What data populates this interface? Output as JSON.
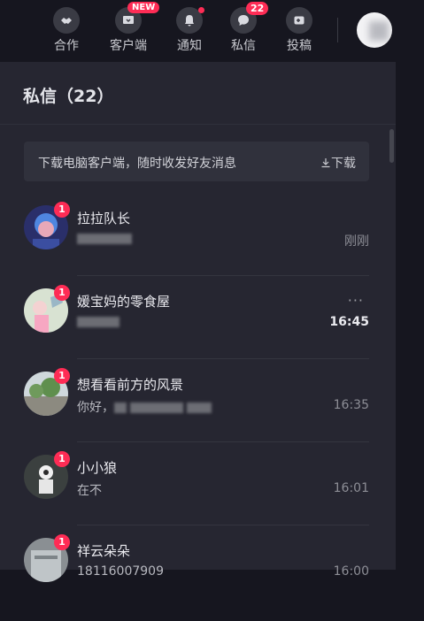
{
  "nav": {
    "items": [
      {
        "label": "合作",
        "icon": "handshake-icon"
      },
      {
        "label": "客户端",
        "icon": "client-icon",
        "badge": "NEW"
      },
      {
        "label": "通知",
        "icon": "bell-icon"
      },
      {
        "label": "私信",
        "icon": "message-icon",
        "badge": "22"
      },
      {
        "label": "投稿",
        "icon": "upload-icon"
      }
    ]
  },
  "panel": {
    "title": "私信（22）",
    "download_banner": {
      "text": "下载电脑客户端，随时收发好友消息",
      "button": "下载"
    }
  },
  "conversations": [
    {
      "name": "拉拉队长",
      "badge": "1",
      "message": "",
      "time": "刚刚"
    },
    {
      "name": "媛宝妈的零食屋",
      "badge": "1",
      "message": "",
      "time": "16:45",
      "more": "···"
    },
    {
      "name": "想看看前方的风景",
      "badge": "1",
      "message": "你好，",
      "time": "16:35"
    },
    {
      "name": "小小狼",
      "badge": "1",
      "message": "在不",
      "time": "16:01"
    },
    {
      "name": "祥云朵朵",
      "badge": "1",
      "message": "18116007909",
      "time": "16:00"
    }
  ],
  "colors": {
    "accent": "#fe2c55",
    "panel_bg": "#262631",
    "page_bg": "#16161f"
  }
}
